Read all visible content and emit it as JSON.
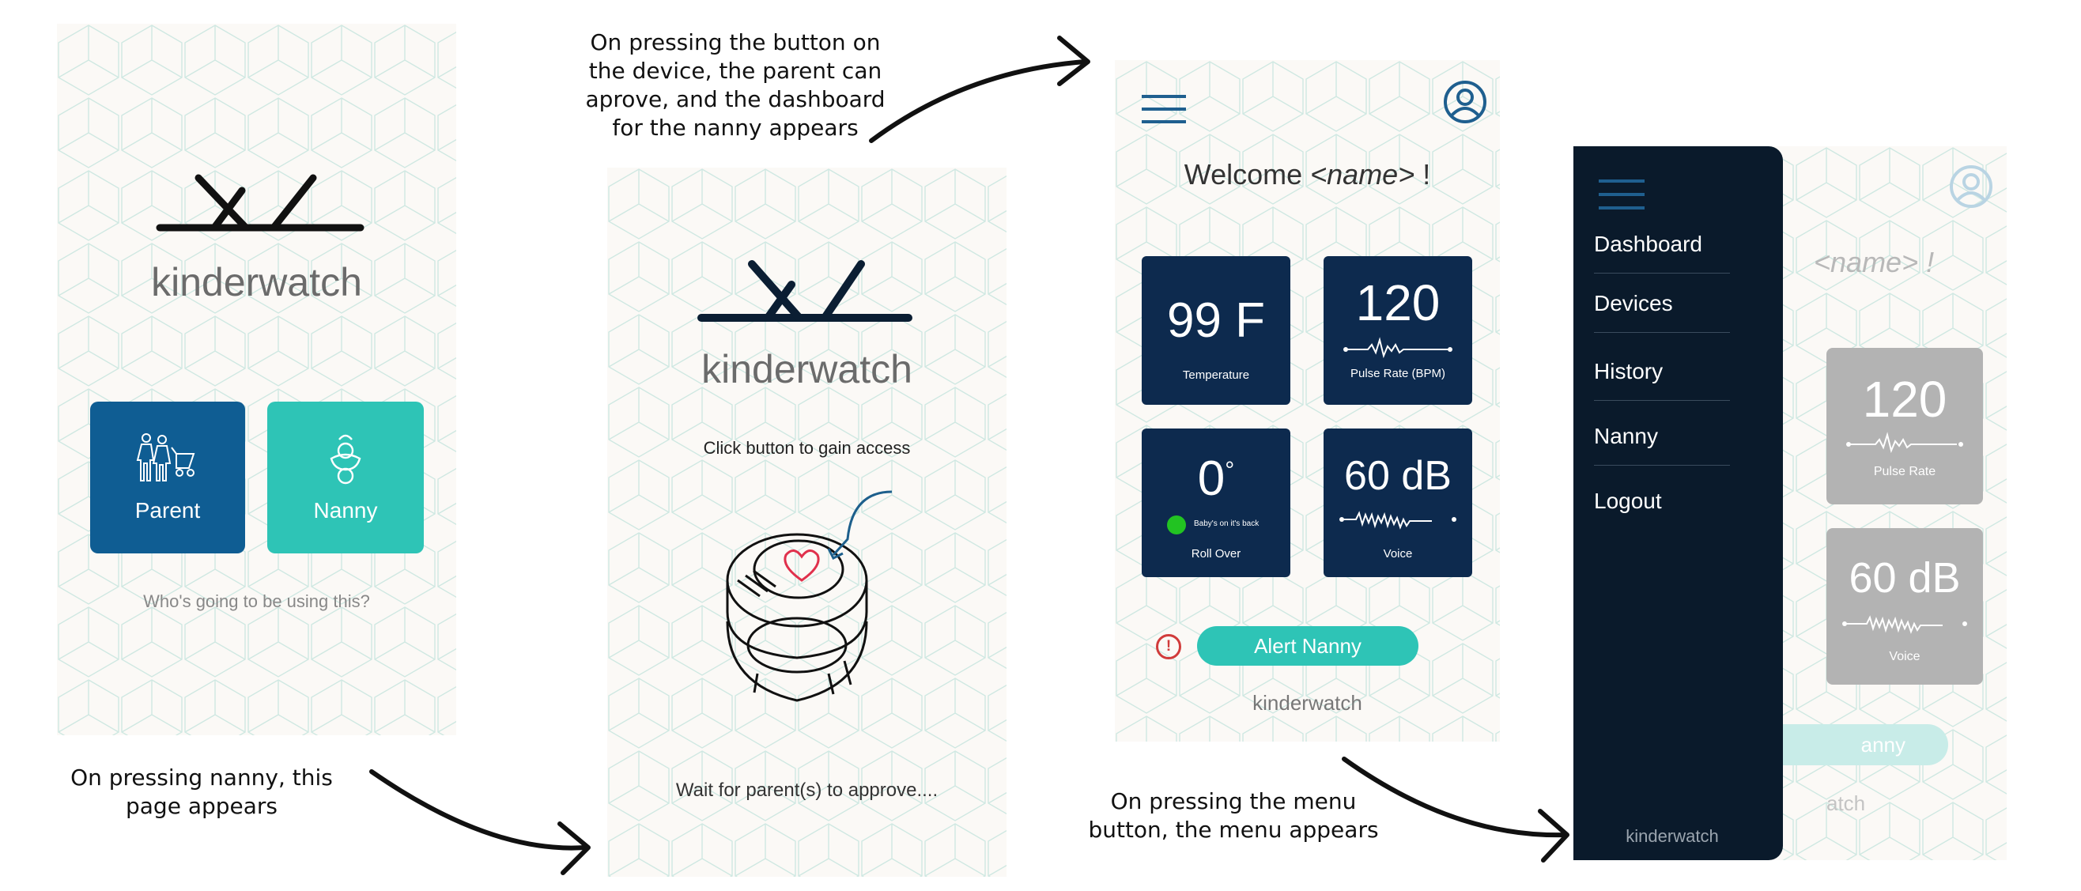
{
  "captions": {
    "top_center": [
      "On pressing the button on",
      "the device, the parent can",
      "aprove, and the dashboard",
      "for the nanny appears"
    ],
    "bottom_left": [
      "On pressing nanny, this",
      "page appears"
    ],
    "bottom_right": [
      "On pressing the menu",
      "button, the menu appears"
    ]
  },
  "screen1": {
    "logo_text": "kinderwatch",
    "parent_label": "Parent",
    "nanny_label": "Nanny",
    "prompt": "Who's going to be using this?"
  },
  "screen2": {
    "logo_text": "kinderwatch",
    "instruction": "Click button to gain access",
    "waiting": "Wait for parent(s) to approve...."
  },
  "screen3": {
    "welcome_prefix": "Welcome ",
    "welcome_name": "<name>",
    "welcome_suffix": " !",
    "tiles": {
      "temperature_value": "99 F",
      "temperature_label": "Temperature",
      "pulse_value": "120",
      "pulse_label": "Pulse Rate (BPM)",
      "rollover_value": "0",
      "rollover_degree": "°",
      "rollover_status": "Baby's on it's back",
      "rollover_label": "Roll Over",
      "voice_value": "60 dB",
      "voice_label": "Voice"
    },
    "alert_icon": "!",
    "alert_button": "Alert Nanny",
    "footer": "kinderwatch"
  },
  "screen4": {
    "menu_items": [
      "Dashboard",
      "Devices",
      "History",
      "Nanny",
      "Logout"
    ],
    "menu_footer": "kinderwatch",
    "behind_name": "<name> !",
    "pulse_value": "120",
    "pulse_label": "Pulse Rate",
    "voice_value": "60 dB",
    "voice_label": "Voice",
    "button_partial": "anny",
    "footer_partial": "atch"
  },
  "colors": {
    "parent_tile": "#0f5d93",
    "nanny_tile": "#2ec4b6",
    "dashboard_tile": "#0d2a4e",
    "menu_bg": "#0a1a2b",
    "alert_red": "#d13b3b",
    "status_green": "#22c322"
  },
  "icons": {
    "menu": "hamburger-icon",
    "profile": "profile-icon",
    "alert": "alert-icon",
    "device": "kinderwatch-device-illustration"
  }
}
